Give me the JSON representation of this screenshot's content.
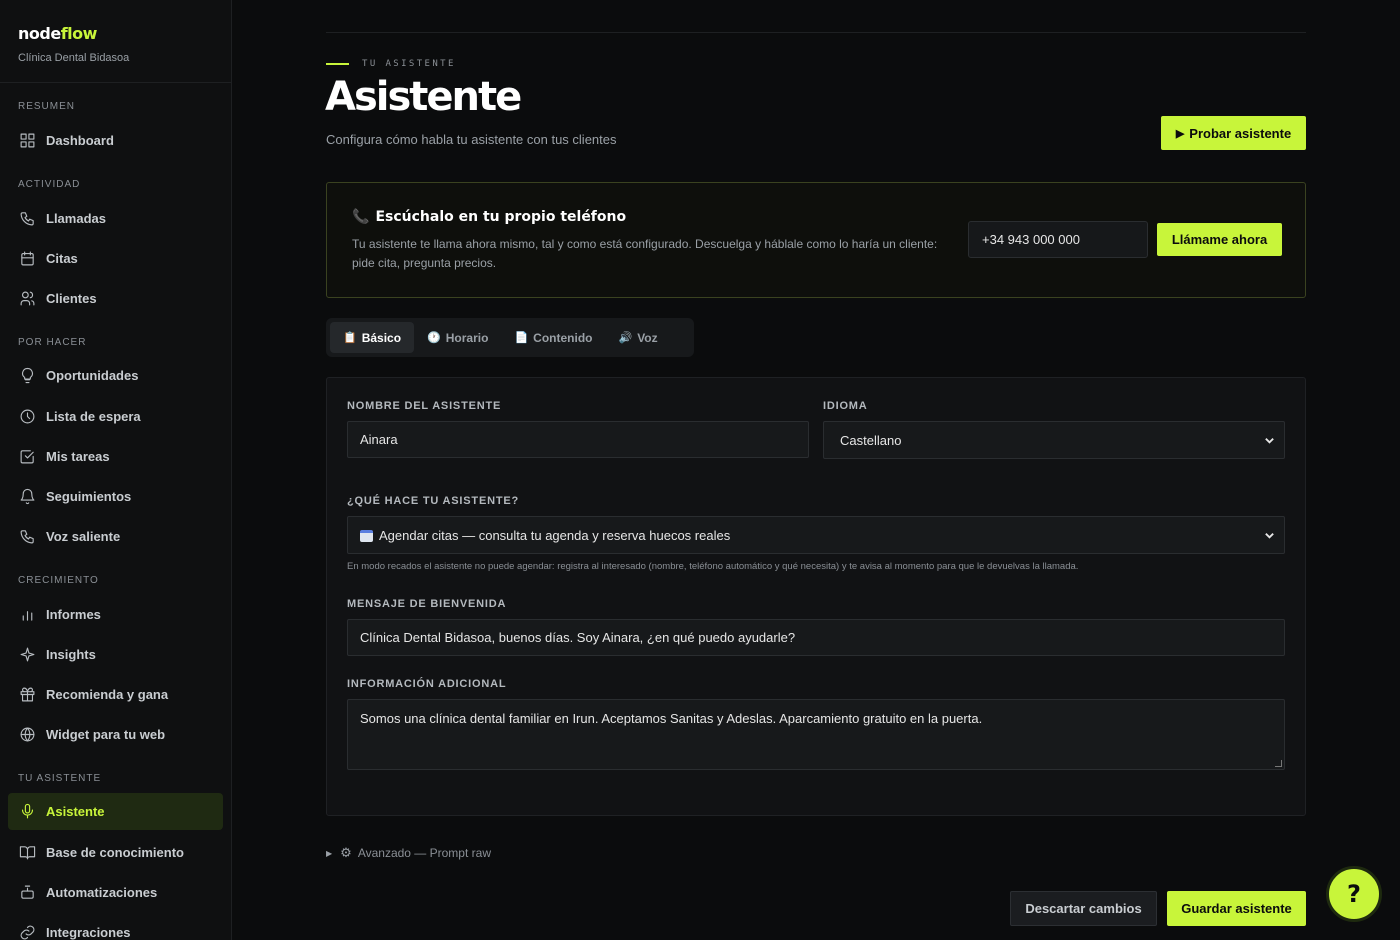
{
  "brand": {
    "name_part1": "node",
    "name_part2": "flow",
    "subtitle": "Clínica Dental Bidasoa"
  },
  "sidebar": {
    "sections": [
      {
        "title": "RESUMEN",
        "items": [
          {
            "label": "Dashboard",
            "icon": "grid-icon"
          }
        ]
      },
      {
        "title": "ACTIVIDAD",
        "items": [
          {
            "label": "Llamadas",
            "icon": "phone-icon"
          },
          {
            "label": "Citas",
            "icon": "calendar-icon"
          },
          {
            "label": "Clientes",
            "icon": "users-icon"
          }
        ]
      },
      {
        "title": "POR HACER",
        "items": [
          {
            "label": "Oportunidades",
            "icon": "lightbulb-icon"
          },
          {
            "label": "Lista de espera",
            "icon": "clock-icon"
          },
          {
            "label": "Mis tareas",
            "icon": "checkbox-icon"
          },
          {
            "label": "Seguimientos",
            "icon": "bell-icon"
          },
          {
            "label": "Voz saliente",
            "icon": "phone-outgoing-icon"
          }
        ]
      },
      {
        "title": "CRECIMIENTO",
        "items": [
          {
            "label": "Informes",
            "icon": "bar-chart-icon"
          },
          {
            "label": "Insights",
            "icon": "sparkle-icon"
          },
          {
            "label": "Recomienda y gana",
            "icon": "gift-icon"
          },
          {
            "label": "Widget para tu web",
            "icon": "globe-icon"
          }
        ]
      },
      {
        "title": "TU ASISTENTE",
        "items": [
          {
            "label": "Asistente",
            "icon": "microphone-icon",
            "active": true
          },
          {
            "label": "Base de conocimiento",
            "icon": "book-icon"
          },
          {
            "label": "Automatizaciones",
            "icon": "robot-icon"
          },
          {
            "label": "Integraciones",
            "icon": "link-icon"
          }
        ]
      }
    ]
  },
  "header": {
    "eyebrow": "TU ASISTENTE",
    "title": "Asistente",
    "subtitle": "Configura cómo habla tu asistente con tus clientes",
    "test_button": "Probar asistente"
  },
  "call_card": {
    "title": "Escúchalo en tu propio teléfono",
    "description": "Tu asistente te llama ahora mismo, tal y como está configurado. Descuelga y háblale como lo haría un cliente: pide cita, pregunta precios.",
    "phone_value": "+34 943 000 000",
    "call_button": "Llámame ahora"
  },
  "tabs": [
    {
      "label": "Básico",
      "icon": "clipboard-icon",
      "active": true
    },
    {
      "label": "Horario",
      "icon": "clock-icon"
    },
    {
      "label": "Contenido",
      "icon": "document-icon"
    },
    {
      "label": "Voz",
      "icon": "speaker-icon"
    }
  ],
  "form": {
    "name_label": "NOMBRE DEL ASISTENTE",
    "name_value": "Ainara",
    "language_label": "IDIOMA",
    "language_value": "Castellano",
    "role_label": "¿QUÉ HACE TU ASISTENTE?",
    "role_value": "Agendar citas — consulta tu agenda y reserva huecos reales",
    "role_help": "En modo recados el asistente no puede agendar: registra al interesado (nombre, teléfono automático y qué necesita) y te avisa al momento para que le devuelvas la llamada.",
    "welcome_label": "MENSAJE DE BIENVENIDA",
    "welcome_value": "Clínica Dental Bidasoa, buenos días. Soy Ainara, ¿en qué puedo ayudarle?",
    "extra_label": "INFORMACIÓN ADICIONAL",
    "extra_value": "Somos una clínica dental familiar en Irun. Aceptamos Sanitas y Adeslas. Aparcamiento gratuito en la puerta."
  },
  "advanced": {
    "label": "Avanzado — Prompt raw"
  },
  "footer": {
    "discard_label": "Descartar cambios",
    "save_label": "Guardar asistente",
    "help_label": "?"
  },
  "colors": {
    "accent": "#c8f53a",
    "background": "#0b0c0d",
    "phone_icon": "#e0457b"
  }
}
